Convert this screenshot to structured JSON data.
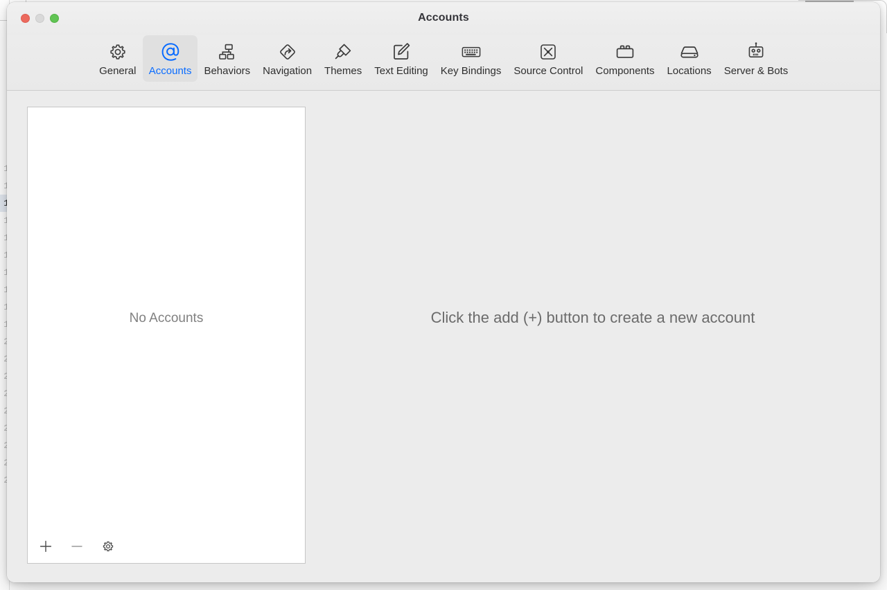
{
  "background": {
    "gutter_numbers": [
      "1",
      "1",
      "1",
      "1",
      "1",
      "1",
      "1",
      "1",
      "1",
      "1",
      "2",
      "2",
      "2",
      "2",
      "2",
      "2",
      "2",
      "2",
      "2"
    ],
    "current_line_index": 2
  },
  "window": {
    "title": "Accounts",
    "traffic_lights": [
      {
        "name": "close-button",
        "color": "#ec6a5e"
      },
      {
        "name": "minimize-button",
        "color": "#d9d9d9"
      },
      {
        "name": "zoom-button",
        "color": "#61c454"
      }
    ]
  },
  "toolbar": {
    "selected": "Accounts",
    "accent_color": "#0a6cff",
    "items": [
      {
        "label": "General",
        "icon": "gear-icon"
      },
      {
        "label": "Accounts",
        "icon": "at-sign-icon"
      },
      {
        "label": "Behaviors",
        "icon": "hierarchy-icon"
      },
      {
        "label": "Navigation",
        "icon": "road-sign-arrow-icon"
      },
      {
        "label": "Themes",
        "icon": "paint-brush-icon"
      },
      {
        "label": "Text Editing",
        "icon": "pencil-square-icon"
      },
      {
        "label": "Key Bindings",
        "icon": "keyboard-icon"
      },
      {
        "label": "Source Control",
        "icon": "merge-branch-square-icon"
      },
      {
        "label": "Components",
        "icon": "toolbox-icon"
      },
      {
        "label": "Locations",
        "icon": "hard-drive-icon"
      },
      {
        "label": "Server & Bots",
        "icon": "robot-icon"
      }
    ]
  },
  "accounts_panel": {
    "empty_label": "No Accounts",
    "footer_buttons": [
      {
        "name": "add-account-button",
        "icon": "plus-icon"
      },
      {
        "name": "remove-account-button",
        "icon": "minus-icon"
      },
      {
        "name": "account-options-button",
        "icon": "gear-icon"
      }
    ]
  },
  "detail_pane": {
    "message": "Click the add (+) button to create a new account"
  }
}
